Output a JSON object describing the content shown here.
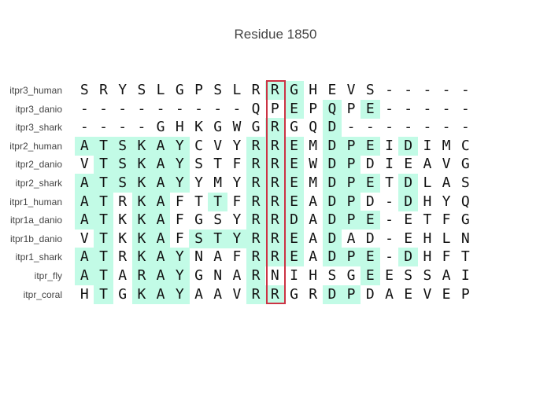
{
  "title": "Residue 1850",
  "colors": {
    "highlight": "#c2fbe6",
    "box": "#cc3344",
    "text": "#111111",
    "label": "#444444"
  },
  "highlight_column": 10,
  "alignment": [
    {
      "name": "itpr3_human",
      "seq": "SRYSLGPSLRRGHEVS-----",
      "hl": [
        10,
        11
      ]
    },
    {
      "name": "itpr3_danio",
      "seq": "---------QPEPQPE-----",
      "hl": [
        11,
        13,
        15
      ]
    },
    {
      "name": "itpr3_shark",
      "seq": "----GHKGWGRGQD-------",
      "hl": [
        10,
        13
      ]
    },
    {
      "name": "itpr2_human",
      "seq": "ATSKAYCVYRREMDPEIDIMC",
      "hl": [
        0,
        1,
        2,
        3,
        4,
        5,
        9,
        10,
        11,
        13,
        14,
        15,
        17
      ]
    },
    {
      "name": "itpr2_danio",
      "seq": "VTSKAYSTFRREWDPDIEAVG",
      "hl": [
        1,
        2,
        3,
        4,
        5,
        9,
        10,
        11,
        13,
        14
      ]
    },
    {
      "name": "itpr2_shark",
      "seq": "ATSKAYYMYRREMDPETDLAS",
      "hl": [
        0,
        1,
        2,
        3,
        4,
        5,
        9,
        10,
        11,
        13,
        14,
        15,
        17
      ]
    },
    {
      "name": "itpr1_human",
      "seq": "ATRKAFTTFRREADPD-DHYQ",
      "hl": [
        0,
        1,
        3,
        4,
        7,
        9,
        10,
        11,
        13,
        14,
        17
      ]
    },
    {
      "name": "itpr1a_danio",
      "seq": "ATKKAFGSYRRDADPE-ETFG",
      "hl": [
        0,
        1,
        3,
        4,
        9,
        10,
        11,
        13,
        14,
        15
      ]
    },
    {
      "name": "itpr1b_danio",
      "seq": "VTKKAFSTYRREADAD-EHLN",
      "hl": [
        1,
        3,
        4,
        6,
        7,
        8,
        9,
        10,
        11,
        13
      ]
    },
    {
      "name": "itpr1_shark",
      "seq": "ATRKAYNAFRREADPE-DHFT",
      "hl": [
        0,
        1,
        3,
        4,
        5,
        9,
        10,
        11,
        13,
        14,
        15,
        17
      ]
    },
    {
      "name": "itpr_fly",
      "seq": "ATARAYGNARNIHSGEESSAI",
      "hl": [
        0,
        1,
        3,
        4,
        5,
        9,
        15
      ]
    },
    {
      "name": "itpr_coral",
      "seq": "HTGKAYAAVRRGRDPDAEVEP",
      "hl": [
        1,
        3,
        4,
        5,
        9,
        10,
        13,
        14
      ]
    }
  ]
}
